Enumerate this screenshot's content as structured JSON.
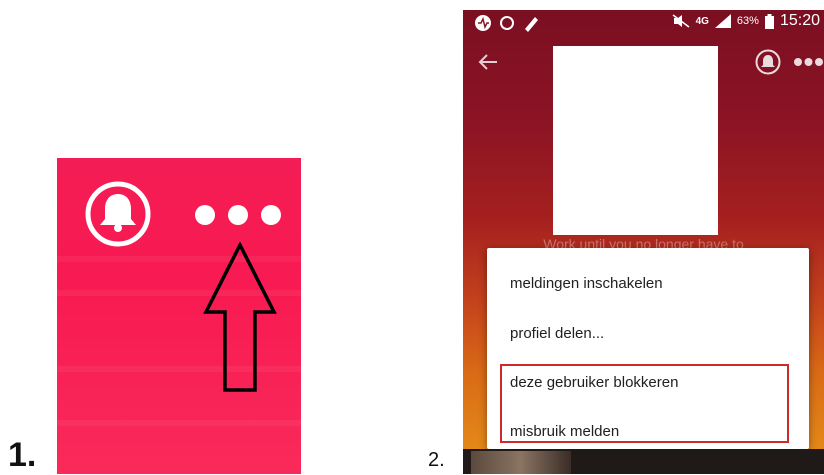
{
  "step_labels": {
    "first": "1.",
    "second": "2."
  },
  "panel1": {
    "icons": [
      "bell-icon",
      "more-dots-icon",
      "arrow-up-icon"
    ],
    "background": "#f81a52"
  },
  "panel2": {
    "status_bar": {
      "network": "4G",
      "battery": "63%",
      "time": "15:20"
    },
    "bio_text": "Work until you no longer have to",
    "menu": {
      "items": [
        "meldingen inschakelen",
        "profiel delen...",
        "deze gebruiker blokkeren",
        "misbruik melden"
      ]
    },
    "highlight_color": "#cc2b2b"
  }
}
